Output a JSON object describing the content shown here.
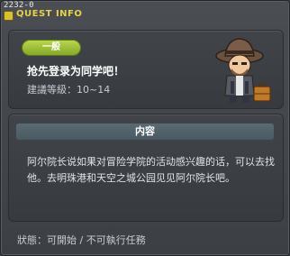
{
  "quest_id": "2232-0",
  "title": "QUEST INFO",
  "category_badge": "一般",
  "quest_name": "抢先登录为同学吧！",
  "level_requirement": "建議等級：10~14",
  "section_header": "内容",
  "description": "阿尔院长说如果对冒险学院的活动感兴趣的话，可以去找他。去明珠港和天空之城公园见见阿尔院长吧。",
  "status": "狀態：可開始 / 不可執行任務",
  "colors": {
    "title": "#e8d048",
    "badge": "#a4c23c"
  },
  "icons": {
    "title_icon": "quest-square-icon",
    "npc": "npc-portrait-icon"
  }
}
